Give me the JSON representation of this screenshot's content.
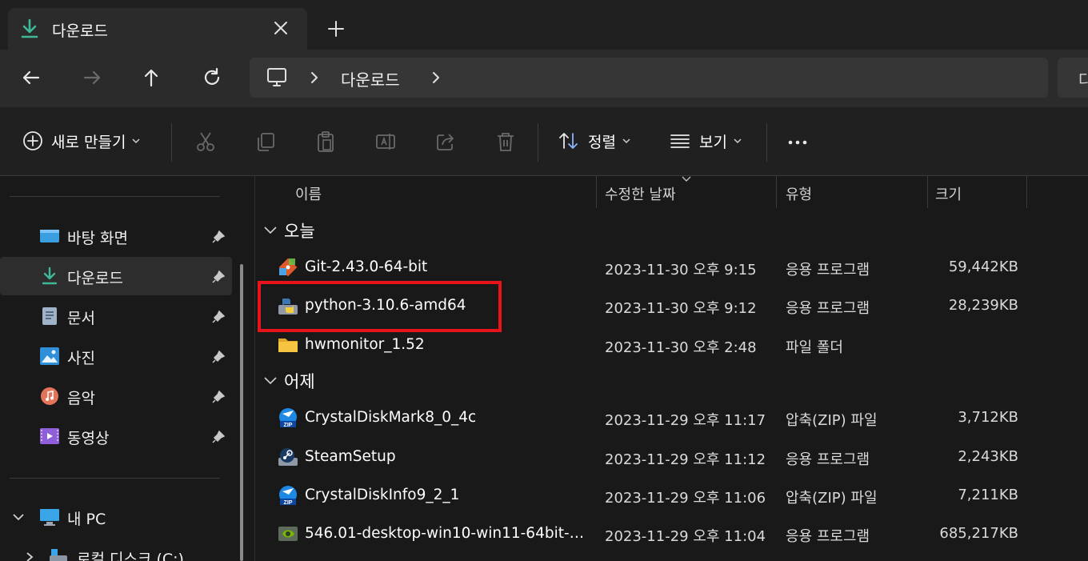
{
  "tab": {
    "title": "다운로드",
    "close_icon": "close-icon",
    "new_tab_icon": "plus-icon"
  },
  "nav": {
    "back_icon": "arrow-left-icon",
    "forward_icon": "arrow-right-icon",
    "up_icon": "arrow-up-icon",
    "refresh_icon": "refresh-icon"
  },
  "address": {
    "root_icon": "monitor-icon",
    "segment": "다운로드",
    "search_partial": "다"
  },
  "toolbar": {
    "new_label": "새로 만들기",
    "sort_label": "정렬",
    "view_label": "보기"
  },
  "sidebar": {
    "items": [
      {
        "label": "바탕 화면",
        "icon": "desktop-icon"
      },
      {
        "label": "다운로드",
        "icon": "download-icon"
      },
      {
        "label": "문서",
        "icon": "document-icon"
      },
      {
        "label": "사진",
        "icon": "pictures-icon"
      },
      {
        "label": "음악",
        "icon": "music-icon"
      },
      {
        "label": "동영상",
        "icon": "video-icon"
      }
    ],
    "pc_label": "내 PC",
    "drive_label": "로컬 디스크 (C:)"
  },
  "columns": {
    "name": "이름",
    "date": "수정한 날짜",
    "type": "유형",
    "size": "크기"
  },
  "groups": {
    "today": "오늘",
    "yesterday": "어제"
  },
  "files": [
    {
      "name": "Git-2.43.0-64-bit",
      "date": "2023-11-30 오후 9:15",
      "type": "응용 프로그램",
      "size": "59,442KB",
      "icon": "git-icon"
    },
    {
      "name": "python-3.10.6-amd64",
      "date": "2023-11-30 오후 9:12",
      "type": "응용 프로그램",
      "size": "28,239KB",
      "icon": "python-installer-icon"
    },
    {
      "name": "hwmonitor_1.52",
      "date": "2023-11-30 오후 2:48",
      "type": "파일 폴더",
      "size": "",
      "icon": "folder-icon"
    },
    {
      "name": "CrystalDiskMark8_0_4c",
      "date": "2023-11-29 오후 11:17",
      "type": "압축(ZIP) 파일",
      "size": "3,712KB",
      "icon": "zip-icon"
    },
    {
      "name": "SteamSetup",
      "date": "2023-11-29 오후 11:12",
      "type": "응용 프로그램",
      "size": "2,243KB",
      "icon": "steam-icon"
    },
    {
      "name": "CrystalDiskInfo9_2_1",
      "date": "2023-11-29 오후 11:06",
      "type": "압축(ZIP) 파일",
      "size": "7,211KB",
      "icon": "zip-icon"
    },
    {
      "name": "546.01-desktop-win10-win11-64bit-int...",
      "date": "2023-11-29 오후 11:04",
      "type": "응용 프로그램",
      "size": "685,217KB",
      "icon": "nvidia-icon"
    }
  ],
  "colors": {
    "highlight": "#e8141c",
    "accent_download": "#3fb89a",
    "folder": "#f5c542"
  }
}
